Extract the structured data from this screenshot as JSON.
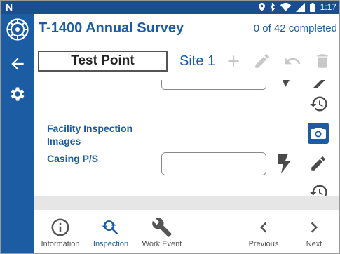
{
  "status_bar": {
    "time": "1:17"
  },
  "header": {
    "title": "T-1400 Annual Survey",
    "progress": "0 of 42 completed"
  },
  "toolbar": {
    "point_name": "Test Point",
    "site": "Site 1"
  },
  "fields": {
    "images_label": "Facility Inspection Images",
    "casing_label": "Casing P/S",
    "casing_value": ""
  },
  "bottom_nav": {
    "information": "Information",
    "inspection": "Inspection",
    "work_event": "Work Event",
    "previous": "Previous",
    "next": "Next"
  },
  "colors": {
    "primary": "#1c5ca3",
    "status_bar": "#1b4e8c",
    "icon_gray": "#4a4a4a",
    "disabled_gray": "#c8c8c8"
  },
  "icons": {
    "rail": [
      "app-logo-icon",
      "back-arrow-icon",
      "gear-icon"
    ],
    "toolbar": [
      "plus-icon",
      "pencil-icon",
      "undo-icon",
      "trash-icon"
    ],
    "field": [
      "lightning-icon",
      "pencil-icon",
      "history-icon",
      "camera-icon"
    ],
    "nav": [
      "info-icon",
      "inspection-icon",
      "wrench-icon",
      "chevron-left-icon",
      "chevron-right-icon"
    ]
  }
}
